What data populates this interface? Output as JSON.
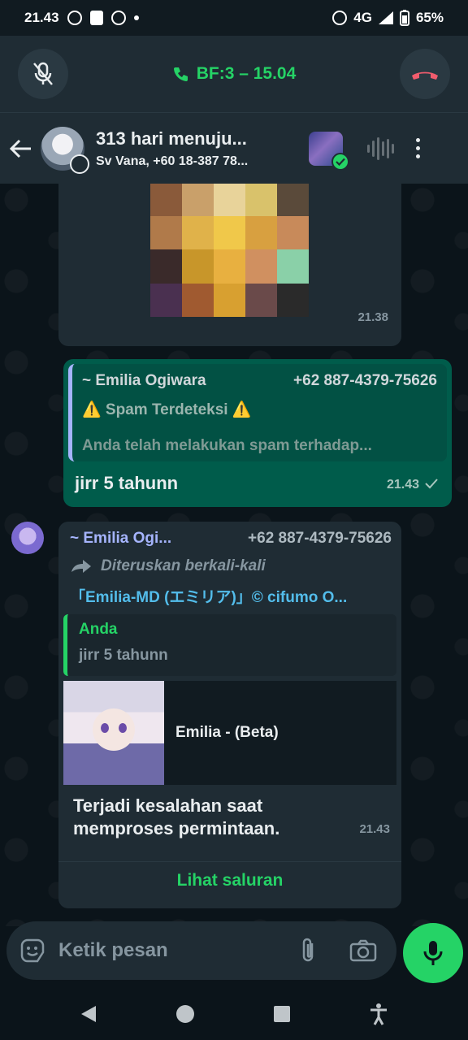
{
  "status_bar": {
    "time": "21.43",
    "network": "4G",
    "battery": "65%"
  },
  "call_bar": {
    "label": "BF:3 – 15.04",
    "mute_icon": "mic-off-icon",
    "end_icon": "end-call-icon"
  },
  "header": {
    "title": "313 hari menuju...",
    "subtitle": "Sv Vana, +60 18-387 78..."
  },
  "messages": {
    "image_message": {
      "time": "21.38"
    },
    "outgoing_reply": {
      "quote_name": "~ Emilia Ogiwara",
      "quote_phone": "+62 887-4379-75626",
      "quote_line1": "⚠️ Spam Terdeteksi ⚠️",
      "quote_line2": "Anda telah melakukan spam terhadap...",
      "text": "jirr 5 tahunn",
      "time": "21.43"
    },
    "incoming_forward": {
      "sender_name": "~ Emilia Ogi...",
      "sender_phone": "+62 887-4379-75626",
      "forwarded_label": "Diteruskan berkali-kali",
      "channel": "「Emilia-MD (エミリア)」© cifumo O...",
      "quote_name": "Anda",
      "quote_text": "jirr 5 tahunn",
      "preview_title": "Emilia - (Beta)",
      "text": "Terjadi kesalahan saat memproses permintaan.",
      "time": "21.43",
      "action": "Lihat saluran"
    }
  },
  "input": {
    "placeholder": "Ketik pesan"
  },
  "colors": {
    "accent": "#25d366",
    "outgoing": "#005c4b",
    "incoming": "#1f2c34",
    "background": "#0b141a"
  }
}
